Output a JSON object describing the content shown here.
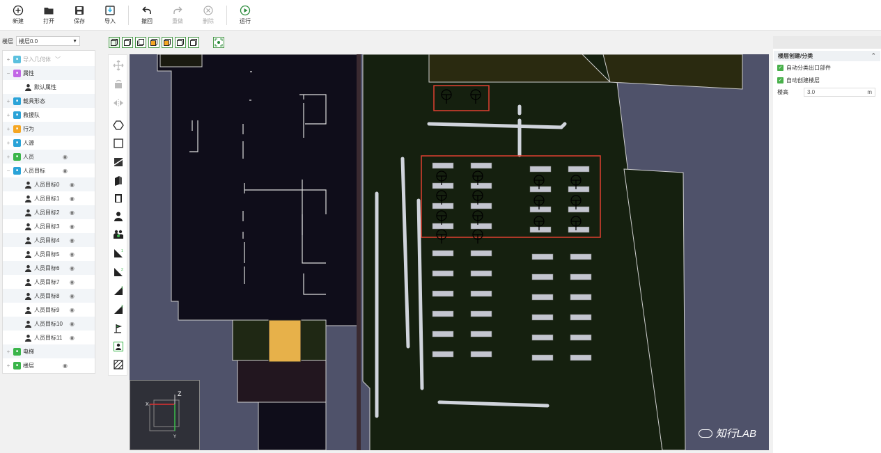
{
  "toolbar": {
    "new": "新建",
    "open": "打开",
    "save": "保存",
    "import": "导入",
    "undo": "撤回",
    "redo": "重做",
    "delete": "删除",
    "run": "运行"
  },
  "floorbar": {
    "label": "楼层",
    "selected": "楼层0.0"
  },
  "tree": {
    "items": [
      {
        "label": "导入几何体",
        "icon_color": "#5bc0de",
        "muted": true
      },
      {
        "label": "属性",
        "icon_color": "#c268e6"
      },
      {
        "label": "默认属性",
        "child": true
      },
      {
        "label": "载具形态",
        "icon_color": "#2aa3d8"
      },
      {
        "label": "救援队",
        "icon_color": "#2aa3d8"
      },
      {
        "label": "行为",
        "icon_color": "#f5a623"
      },
      {
        "label": "人源",
        "icon_color": "#2aa3d8"
      },
      {
        "label": "人员",
        "icon_color": "#3ab54a",
        "eye": true
      },
      {
        "label": "人员目标",
        "icon_color": "#2aa3d8",
        "eye": true
      },
      {
        "label": "人员目标0",
        "child": true
      },
      {
        "label": "人员目标1",
        "child": true
      },
      {
        "label": "人员目标2",
        "child": true
      },
      {
        "label": "人员目标3",
        "child": true
      },
      {
        "label": "人员目标4",
        "child": true
      },
      {
        "label": "人员目标5",
        "child": true
      },
      {
        "label": "人员目标6",
        "child": true
      },
      {
        "label": "人员目标7",
        "child": true
      },
      {
        "label": "人员目标8",
        "child": true
      },
      {
        "label": "人员目标9",
        "child": true
      },
      {
        "label": "人员目标10",
        "child": true
      },
      {
        "label": "人员目标11",
        "child": true
      },
      {
        "label": "电梯",
        "icon_color": "#3ab54a"
      },
      {
        "label": "楼层",
        "icon_color": "#3ab54a",
        "eye": true
      }
    ]
  },
  "axes": {
    "x": "X",
    "y": "Y",
    "z": "Z"
  },
  "watermark": "知行LAB",
  "rpanel": {
    "section_title": "楼层创建/分类",
    "check1": "自动分类出口部件",
    "check2": "自动创建楼层",
    "height_label": "楼高",
    "height_value": "3.0",
    "height_unit": "m"
  }
}
